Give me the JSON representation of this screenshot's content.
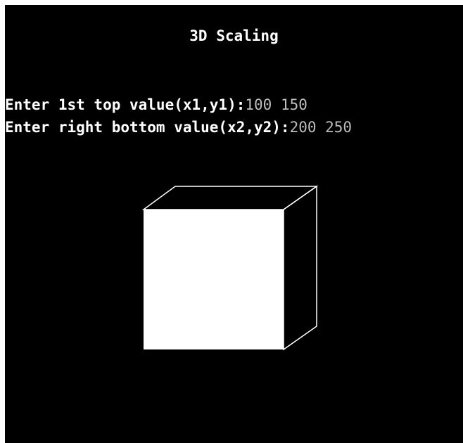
{
  "window": {
    "title": "3D Scaling"
  },
  "prompts": [
    {
      "label": "Enter 1st top value(x1,y1):",
      "value": "100 150"
    },
    {
      "label": "Enter right bottom value(x2,y2):",
      "value": "200 250"
    }
  ],
  "colors": {
    "background": "#000000",
    "foreground": "#ffffff",
    "input": "#bdbdbd"
  }
}
